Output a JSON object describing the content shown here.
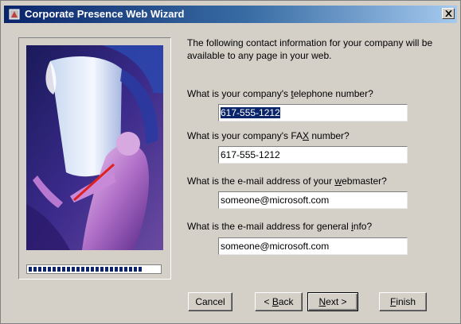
{
  "window": {
    "title": "Corporate Presence Web Wizard"
  },
  "intro_text": "The following contact information for your company will be available to any page in your web.",
  "fields": [
    {
      "label_before": "What is your company's ",
      "label_hotkey": "t",
      "label_after": "elephone number?",
      "value": "617-555-1212",
      "selected": true
    },
    {
      "label_before": "What is your company's FA",
      "label_hotkey": "X",
      "label_after": " number?",
      "value": "617-555-1212",
      "selected": false
    },
    {
      "label_before": "What is the e-mail address of your ",
      "label_hotkey": "w",
      "label_after": "ebmaster?",
      "value": "someone@microsoft.com",
      "selected": false
    },
    {
      "label_before": "What is the e-mail address for general ",
      "label_hotkey": "i",
      "label_after": "nfo?",
      "value": "someone@microsoft.com",
      "selected": false
    }
  ],
  "progress": {
    "fraction": 0.88
  },
  "buttons": {
    "cancel": "Cancel",
    "back_prefix": "< ",
    "back_hotkey": "B",
    "back_suffix": "ack",
    "next_hotkey": "N",
    "next_suffix": "ext >",
    "finish_hotkey": "F",
    "finish_suffix": "inish"
  },
  "icons": {
    "close": "close-icon",
    "app": "wizard-app-icon"
  },
  "colors": {
    "title_bar": "#0a246a",
    "selection": "#0a246a",
    "dialog_face": "#d4d0c8"
  }
}
